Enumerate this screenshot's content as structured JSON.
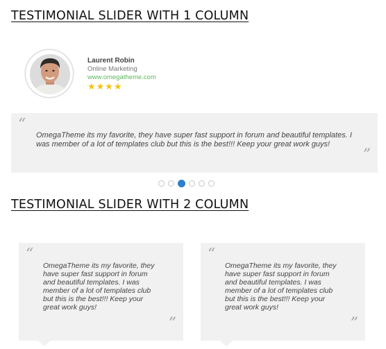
{
  "sections": [
    {
      "title": "TESTIMONIAL SLIDER WITH 1 COLUMN"
    },
    {
      "title": "TESTIMONIAL SLIDER WITH 2 COLUMN"
    }
  ],
  "single_slider": {
    "author": {
      "name": "Laurent Robin",
      "role": "Online Marketing",
      "website": "www.omegatheme.com",
      "rating": 4,
      "stars": "★★★★"
    },
    "quote_open": "“",
    "quote_close": "”",
    "quote": "OmegaTheme its my favorite, they have super fast support in forum and beautiful templates. I was member of a lot of templates club but this is the best!!! Keep your great work guys!",
    "pagination": {
      "total_pages": 6,
      "active_page": 3
    }
  },
  "double_slider": {
    "cards": [
      {
        "quote_open": "“",
        "quote_close": "”",
        "quote": "OmegaTheme its my favorite, they have super fast support in forum and beautiful templates. I was member of a lot of templates club but this is the best!!! Keep your great work guys!"
      },
      {
        "quote_open": "“",
        "quote_close": "”",
        "quote": "OmegaTheme its my favorite, they have super fast support in forum and beautiful templates. I was member of a lot of templates club but this is the best!!! Keep your great work guys!"
      }
    ]
  },
  "colors": {
    "quote_background": "#f1f1f1",
    "star": "#f2c20e",
    "link": "#5cb85c",
    "active_dot": "#2d7fcf"
  },
  "icons": {
    "avatar": "person-photo",
    "rating": "star-icon",
    "quote": "quotation-mark-icon"
  }
}
